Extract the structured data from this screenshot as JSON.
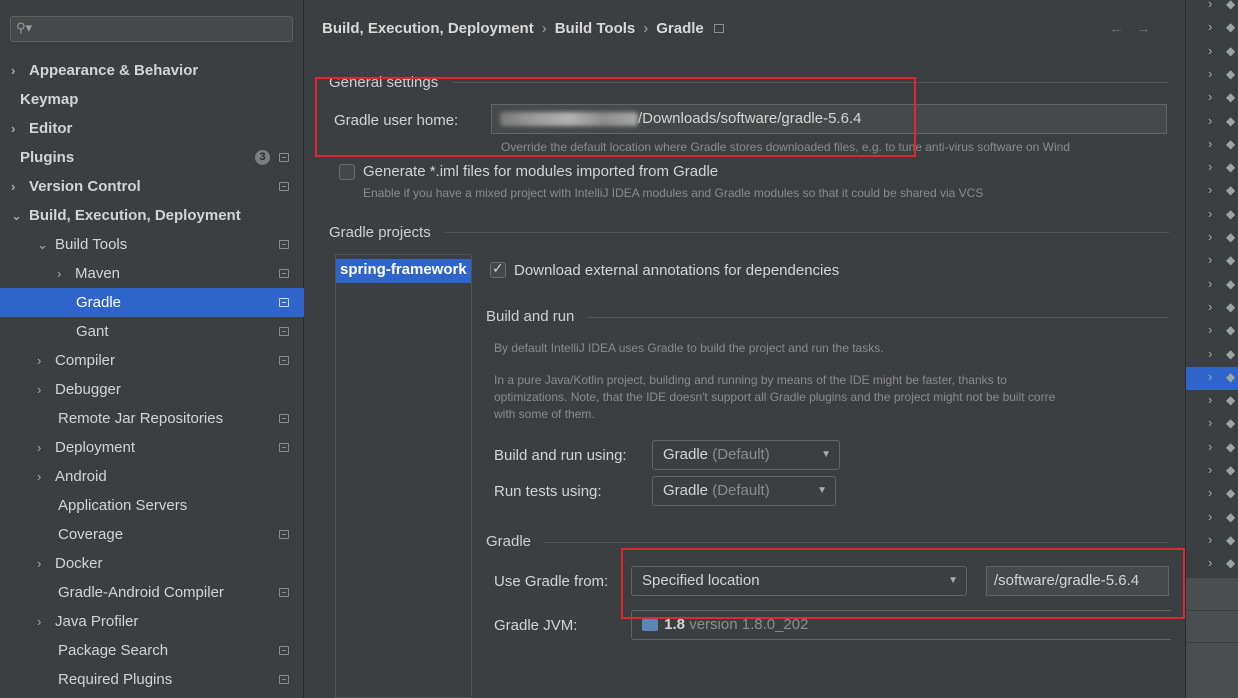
{
  "search": {
    "icon": "search-icon",
    "placeholder": ""
  },
  "sidebar": {
    "items": [
      {
        "label": "Appearance & Behavior",
        "chevron": "›",
        "bold": true
      },
      {
        "label": "Keymap",
        "bold": true
      },
      {
        "label": "Editor",
        "chevron": "›",
        "bold": true
      },
      {
        "label": "Plugins",
        "bold": true,
        "badge": "3"
      },
      {
        "label": "Version Control",
        "chevron": "›",
        "bold": true
      },
      {
        "label": "Build, Execution, Deployment",
        "chevron": "⌄",
        "bold": true
      },
      {
        "label": "Build Tools",
        "chevron": "⌄"
      },
      {
        "label": "Maven",
        "chevron": "›"
      },
      {
        "label": "Gradle",
        "selected": true
      },
      {
        "label": "Gant"
      },
      {
        "label": "Compiler",
        "chevron": "›"
      },
      {
        "label": "Debugger",
        "chevron": "›"
      },
      {
        "label": "Remote Jar Repositories"
      },
      {
        "label": "Deployment",
        "chevron": "›"
      },
      {
        "label": "Android",
        "chevron": "›"
      },
      {
        "label": "Application Servers"
      },
      {
        "label": "Coverage"
      },
      {
        "label": "Docker",
        "chevron": "›"
      },
      {
        "label": "Gradle-Android Compiler"
      },
      {
        "label": "Java Profiler",
        "chevron": "›"
      },
      {
        "label": "Package Search"
      },
      {
        "label": "Required Plugins"
      }
    ]
  },
  "breadcrumb": {
    "part1": "Build, Execution, Deployment",
    "sep1": "›",
    "part2": "Build Tools",
    "sep2": "›",
    "part3": "Gradle",
    "back_icon": "←",
    "forward_icon": "→"
  },
  "general": {
    "title": "General settings",
    "gradle_home_label": "Gradle user home:",
    "gradle_home_value": "/Downloads/software/gradle-5.6.4",
    "gradle_home_hint": "Override the default location where Gradle stores downloaded files, e.g. to tune anti-virus software on Wind",
    "iml_label": "Generate *.iml files for modules imported from Gradle",
    "iml_checked": false,
    "iml_hint": "Enable if you have a mixed project with IntelliJ IDEA modules and Gradle modules so that it could be shared via VCS"
  },
  "projects": {
    "title": "Gradle projects",
    "selected_project": "spring-framework",
    "download_annotations_label": "Download external annotations for dependencies",
    "download_annotations_checked": true,
    "build_run": {
      "title": "Build and run",
      "hint1": "By default IntelliJ IDEA uses Gradle to build the project and run the tasks.",
      "hint2_line1": "In a pure Java/Kotlin project, building and running by means of the IDE might be faster, thanks to",
      "hint2_line2": "optimizations. Note, that the IDE doesn't support all Gradle plugins and the project might not be built corre",
      "hint2_line3": "with some of them.",
      "build_using_label": "Build and run using:",
      "build_using_value": "Gradle",
      "build_using_suffix": "(Default)",
      "tests_using_label": "Run tests using:",
      "tests_using_value": "Gradle",
      "tests_using_suffix": "(Default)"
    },
    "gradle": {
      "title": "Gradle",
      "use_from_label": "Use Gradle from:",
      "use_from_value": "Specified location",
      "location_value": "/software/gradle-5.6.4",
      "jvm_label": "Gradle JVM:",
      "jvm_version": "1.8",
      "jvm_detail": "version 1.8.0_202"
    }
  },
  "colors": {
    "accent": "#2f65ca",
    "highlight_box": "#e0262e",
    "background": "#3c3f41"
  }
}
